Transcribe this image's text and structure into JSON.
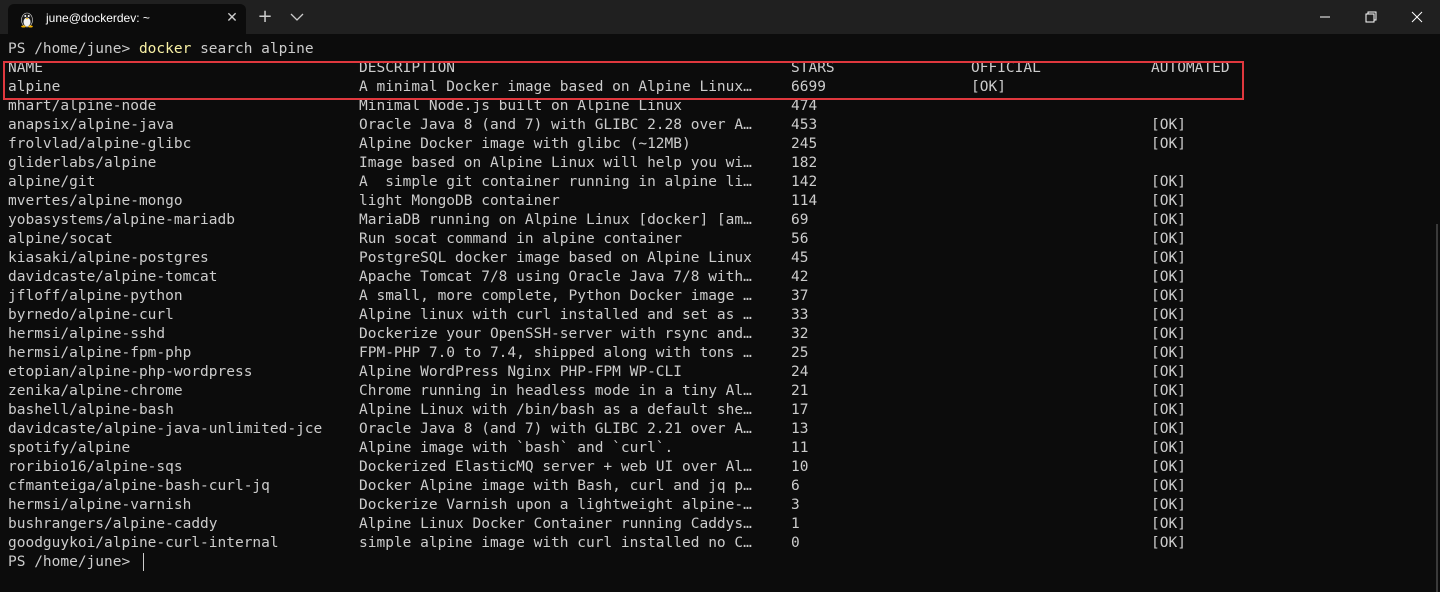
{
  "window": {
    "tab_title": "june@dockerdev: ~",
    "tab_icon": "linux-penguin-icon",
    "new_tab_label": "+",
    "close_tab_label": "✕"
  },
  "terminal": {
    "prompt": "PS /home/june> ",
    "command_keyword": "docker",
    "command_args": " search alpine",
    "headers": {
      "name": "NAME",
      "description": "DESCRIPTION",
      "stars": "STARS",
      "official": "OFFICIAL",
      "automated": "AUTOMATED"
    },
    "rows": [
      {
        "name": "alpine",
        "description": "A minimal Docker image based on Alpine Linux…",
        "stars": "6699",
        "official": "[OK]",
        "automated": ""
      },
      {
        "name": "mhart/alpine-node",
        "description": "Minimal Node.js built on Alpine Linux",
        "stars": "474",
        "official": "",
        "automated": ""
      },
      {
        "name": "anapsix/alpine-java",
        "description": "Oracle Java 8 (and 7) with GLIBC 2.28 over A…",
        "stars": "453",
        "official": "",
        "automated": "[OK]"
      },
      {
        "name": "frolvlad/alpine-glibc",
        "description": "Alpine Docker image with glibc (~12MB)",
        "stars": "245",
        "official": "",
        "automated": "[OK]"
      },
      {
        "name": "gliderlabs/alpine",
        "description": "Image based on Alpine Linux will help you wi…",
        "stars": "182",
        "official": "",
        "automated": ""
      },
      {
        "name": "alpine/git",
        "description": "A  simple git container running in alpine li…",
        "stars": "142",
        "official": "",
        "automated": "[OK]"
      },
      {
        "name": "mvertes/alpine-mongo",
        "description": "light MongoDB container",
        "stars": "114",
        "official": "",
        "automated": "[OK]"
      },
      {
        "name": "yobasystems/alpine-mariadb",
        "description": "MariaDB running on Alpine Linux [docker] [am…",
        "stars": "69",
        "official": "",
        "automated": "[OK]"
      },
      {
        "name": "alpine/socat",
        "description": "Run socat command in alpine container",
        "stars": "56",
        "official": "",
        "automated": "[OK]"
      },
      {
        "name": "kiasaki/alpine-postgres",
        "description": "PostgreSQL docker image based on Alpine Linux",
        "stars": "45",
        "official": "",
        "automated": "[OK]"
      },
      {
        "name": "davidcaste/alpine-tomcat",
        "description": "Apache Tomcat 7/8 using Oracle Java 7/8 with…",
        "stars": "42",
        "official": "",
        "automated": "[OK]"
      },
      {
        "name": "jfloff/alpine-python",
        "description": "A small, more complete, Python Docker image …",
        "stars": "37",
        "official": "",
        "automated": "[OK]"
      },
      {
        "name": "byrnedo/alpine-curl",
        "description": "Alpine linux with curl installed and set as …",
        "stars": "33",
        "official": "",
        "automated": "[OK]"
      },
      {
        "name": "hermsi/alpine-sshd",
        "description": "Dockerize your OpenSSH-server with rsync and…",
        "stars": "32",
        "official": "",
        "automated": "[OK]"
      },
      {
        "name": "hermsi/alpine-fpm-php",
        "description": "FPM-PHP 7.0 to 7.4, shipped along with tons …",
        "stars": "25",
        "official": "",
        "automated": "[OK]"
      },
      {
        "name": "etopian/alpine-php-wordpress",
        "description": "Alpine WordPress Nginx PHP-FPM WP-CLI",
        "stars": "24",
        "official": "",
        "automated": "[OK]"
      },
      {
        "name": "zenika/alpine-chrome",
        "description": "Chrome running in headless mode in a tiny Al…",
        "stars": "21",
        "official": "",
        "automated": "[OK]"
      },
      {
        "name": "bashell/alpine-bash",
        "description": "Alpine Linux with /bin/bash as a default she…",
        "stars": "17",
        "official": "",
        "automated": "[OK]"
      },
      {
        "name": "davidcaste/alpine-java-unlimited-jce",
        "description": "Oracle Java 8 (and 7) with GLIBC 2.21 over A…",
        "stars": "13",
        "official": "",
        "automated": "[OK]"
      },
      {
        "name": "spotify/alpine",
        "description": "Alpine image with `bash` and `curl`.",
        "stars": "11",
        "official": "",
        "automated": "[OK]"
      },
      {
        "name": "roribio16/alpine-sqs",
        "description": "Dockerized ElasticMQ server + web UI over Al…",
        "stars": "10",
        "official": "",
        "automated": "[OK]"
      },
      {
        "name": "cfmanteiga/alpine-bash-curl-jq",
        "description": "Docker Alpine image with Bash, curl and jq p…",
        "stars": "6",
        "official": "",
        "automated": "[OK]"
      },
      {
        "name": "hermsi/alpine-varnish",
        "description": "Dockerize Varnish upon a lightweight alpine-…",
        "stars": "3",
        "official": "",
        "automated": "[OK]"
      },
      {
        "name": "bushrangers/alpine-caddy",
        "description": "Alpine Linux Docker Container running Caddys…",
        "stars": "1",
        "official": "",
        "automated": "[OK]"
      },
      {
        "name": "goodguykoi/alpine-curl-internal",
        "description": "simple alpine image with curl installed no C…",
        "stars": "0",
        "official": "",
        "automated": "[OK]"
      }
    ],
    "final_prompt": "PS /home/june> "
  },
  "colors": {
    "background": "#0c0c0c",
    "text": "#cccccc",
    "command_highlight": "#f9f1a5",
    "annotation_box": "#e0383e"
  }
}
